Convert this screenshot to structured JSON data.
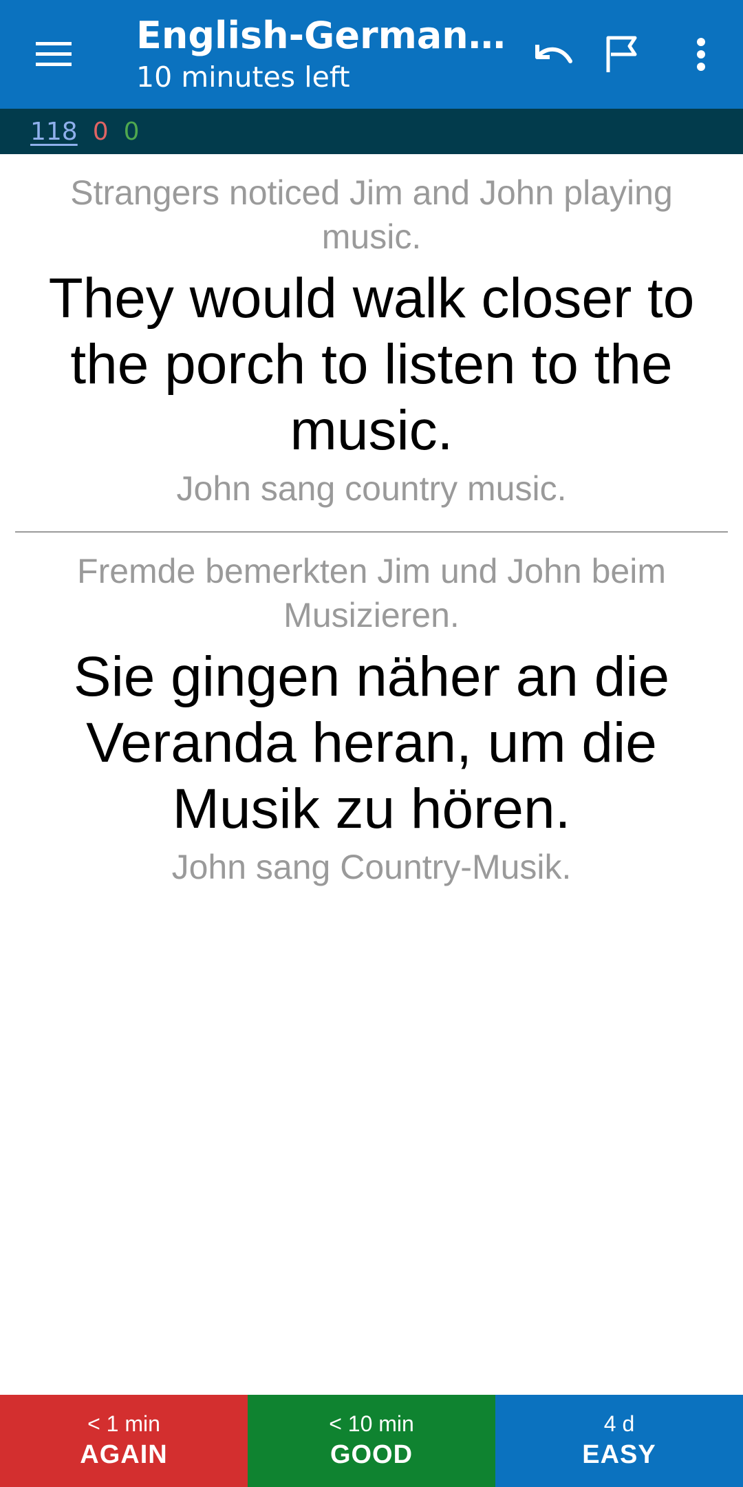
{
  "toolbar": {
    "title": "English-German / En…",
    "subtitle": "10 minutes left",
    "menu_icon": "hamburger-menu-icon",
    "undo_icon": "undo-icon",
    "flag_icon": "flag-icon",
    "more_icon": "more-vert-icon"
  },
  "counts": {
    "new": "118",
    "learn": "0",
    "review": "0"
  },
  "card": {
    "front": {
      "previous": "Strangers noticed Jim and John playing music.",
      "main": "They would walk closer to the porch to listen to the music.",
      "next": "John sang country music."
    },
    "back": {
      "previous": "Fremde bemerkten Jim und John beim Musizieren.",
      "main": "Sie gingen näher an die Veranda heran, um die Musik zu hören.",
      "next": "John sang Country-Musik."
    }
  },
  "answers": {
    "again": {
      "interval": "< 1 min",
      "label": "AGAIN"
    },
    "good": {
      "interval": "< 10 min",
      "label": "GOOD"
    },
    "easy": {
      "interval": "4 d",
      "label": "EASY"
    }
  },
  "colors": {
    "toolbar": "#0b72bf",
    "counts_bar": "#023b4c",
    "again": "#d32f2f",
    "good": "#0f8330",
    "easy": "#0b72bf"
  }
}
